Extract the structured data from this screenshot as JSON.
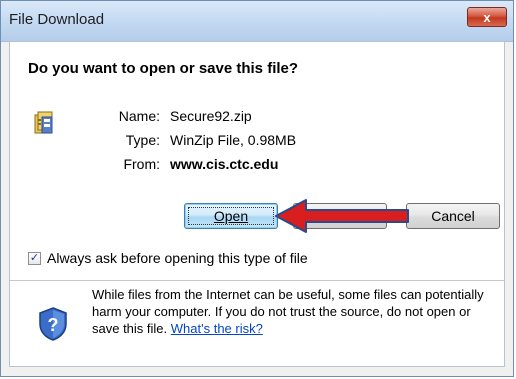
{
  "window": {
    "title": "File Download",
    "close_glyph": "x"
  },
  "dialog": {
    "question": "Do you want to open or save this file?",
    "file_icon": "zip-file-icon",
    "info": {
      "name_label": "Name:",
      "name_value": "Secure92.zip",
      "type_label": "Type:",
      "type_value": "WinZip File, 0.98MB",
      "from_label": "From:",
      "from_value": "www.cis.ctc.edu"
    },
    "buttons": {
      "open": "Open",
      "save": "",
      "cancel": "Cancel"
    },
    "checkbox": {
      "checked": true,
      "label": "Always ask before opening this type of file"
    },
    "warning": {
      "icon": "security-shield-icon",
      "text": "While files from the Internet can be useful, some files can potentially harm your computer. If you do not trust the source, do not open or save this file.",
      "link": "What's the risk?"
    }
  },
  "colors": {
    "annotation_arrow": "#d81e1e",
    "link": "#0645c9"
  }
}
